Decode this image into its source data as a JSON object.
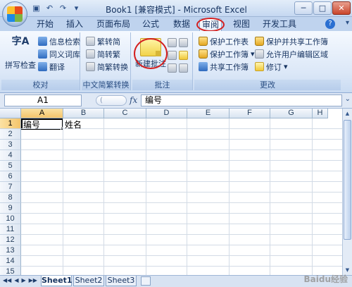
{
  "window": {
    "title": "Book1  [兼容模式] - Microsoft Excel",
    "minimize": "─",
    "maximize": "□",
    "close": "✕"
  },
  "qat": {
    "save": "▣",
    "undo": "↶",
    "redo": "↷",
    "more": "▾"
  },
  "tabs": [
    "开始",
    "插入",
    "页面布局",
    "公式",
    "数据",
    "审阅",
    "视图",
    "开发工具"
  ],
  "active_tab": "审阅",
  "help": "?",
  "ribbon": {
    "proofing": {
      "label": "校对",
      "spell_check": "拼写检查",
      "spell_icon_text": "字A",
      "research": "信息检索",
      "thesaurus": "同义词库",
      "translate": "翻译"
    },
    "chinese_conversion": {
      "label": "中文简繁转换",
      "to_simplified": "繁转简",
      "to_traditional": "简转繁",
      "convert": "简繁转换"
    },
    "comments": {
      "label": "批注",
      "new_comment": "新建批注"
    },
    "changes": {
      "label": "更改",
      "protect_sheet": "保护工作表",
      "protect_workbook": "保护工作簿",
      "share_workbook": "共享工作簿",
      "protect_share": "保护并共享工作簿",
      "allow_edit_ranges": "允许用户编辑区域",
      "track_changes": "修订"
    }
  },
  "formula_bar": {
    "name_box": "A1",
    "fx": "fx",
    "value": "编号"
  },
  "columns": [
    "A",
    "B",
    "C",
    "D",
    "E",
    "F",
    "G",
    "H"
  ],
  "rows": [
    "1",
    "2",
    "3",
    "4",
    "5",
    "6",
    "7",
    "8",
    "9",
    "10",
    "11",
    "12",
    "13",
    "14",
    "15"
  ],
  "cells": {
    "A1": "编号",
    "B1": "姓名"
  },
  "sheets": [
    "Sheet1",
    "Sheet2",
    "Sheet3"
  ],
  "active_sheet": "Sheet1",
  "sheet_nav": {
    "first": "◀◀",
    "prev": "◀",
    "next": "▶",
    "last": "▶▶"
  },
  "watermark": "Baidu经验",
  "colors": {
    "annotation_circle": "#d42020",
    "selected_header": "#f4c46b"
  }
}
